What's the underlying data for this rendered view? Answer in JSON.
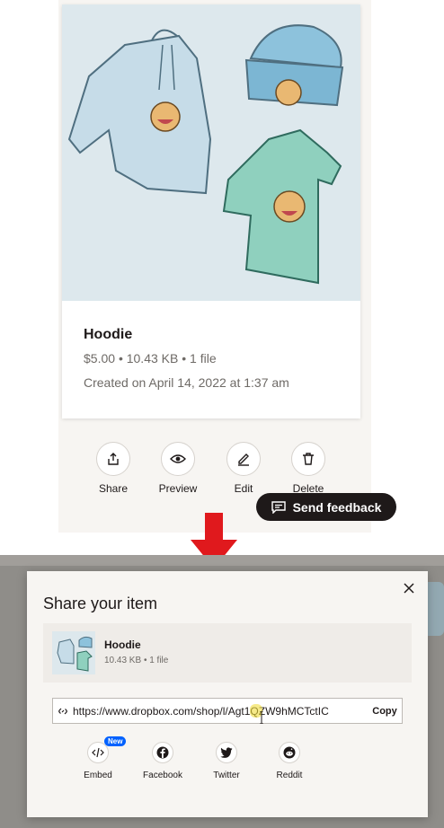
{
  "product": {
    "title": "Hoodie",
    "price": "$5.00",
    "size": "10.43 KB",
    "files": "1 file",
    "created": "Created on April 14, 2022 at 1:37 am"
  },
  "actions": [
    {
      "label": "Share",
      "icon": "share-icon"
    },
    {
      "label": "Preview",
      "icon": "eye-icon"
    },
    {
      "label": "Edit",
      "icon": "pencil-icon"
    },
    {
      "label": "Delete",
      "icon": "trash-icon"
    }
  ],
  "feedback_label": "Send feedback",
  "share_modal": {
    "title": "Share your item",
    "item_name": "Hoodie",
    "item_size": "10.43 KB",
    "item_files": "1 file",
    "link": "https://www.dropbox.com/shop/l/Agt1QZW9hMCTctIC",
    "copy_label": "Copy",
    "targets": [
      {
        "label": "Embed",
        "icon": "code-icon",
        "badge": "New"
      },
      {
        "label": "Facebook",
        "icon": "facebook-icon"
      },
      {
        "label": "Twitter",
        "icon": "twitter-icon"
      },
      {
        "label": "Reddit",
        "icon": "reddit-icon"
      }
    ]
  },
  "colors": {
    "accent_red": "#e0191d",
    "dark_button": "#1e1919",
    "badge_blue": "#0061fe"
  }
}
